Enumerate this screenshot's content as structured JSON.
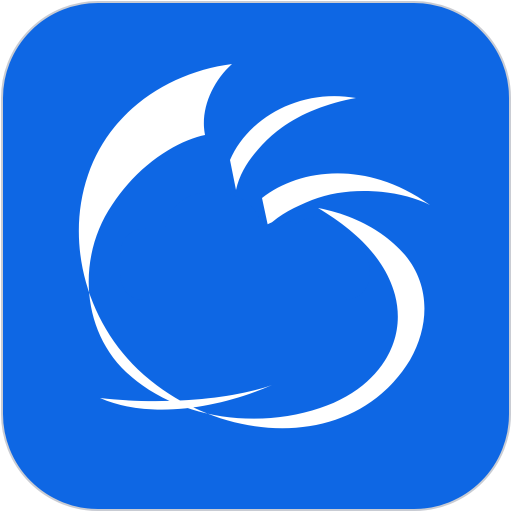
{
  "app_icon": {
    "icon_name": "weather-swirl-cloud-icon",
    "colors": {
      "tile_background": "#0e67e4",
      "tile_border": "#c9ccd3",
      "glyph": "#ffffff"
    }
  }
}
